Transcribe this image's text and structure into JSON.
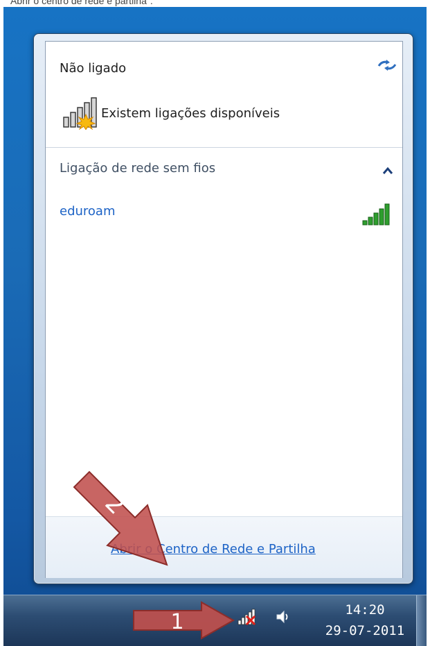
{
  "caption": {
    "text": "\"Abrir o centro de rede e partilha\"."
  },
  "flyout": {
    "status_title": "Não ligado",
    "status_subtitle": "Existem ligações disponíveis",
    "section_label": "Ligação de rede sem fios",
    "networks": [
      {
        "name": "eduroam",
        "signal_strength": "5/5"
      }
    ],
    "footer_link": "Abrir o Centro de Rede e Partilha"
  },
  "taskbar": {
    "time": "14:20",
    "date": "29-07-2011"
  },
  "annotations": {
    "arrow_1_label": "1",
    "arrow_2_label": "2",
    "arrow_color": "#c0504d"
  },
  "colors": {
    "link": "#1d63c6",
    "desktop": "#1a6bb6",
    "signal_green": "#2e9e2e"
  },
  "icons": {
    "refresh": "refresh-icon",
    "status_signal": "signal-warning-icon",
    "collapse": "chevron-up-icon",
    "network_signal": "signal-strength-icon",
    "tray_network": "network-disconnected-icon",
    "tray_volume": "speaker-icon"
  }
}
